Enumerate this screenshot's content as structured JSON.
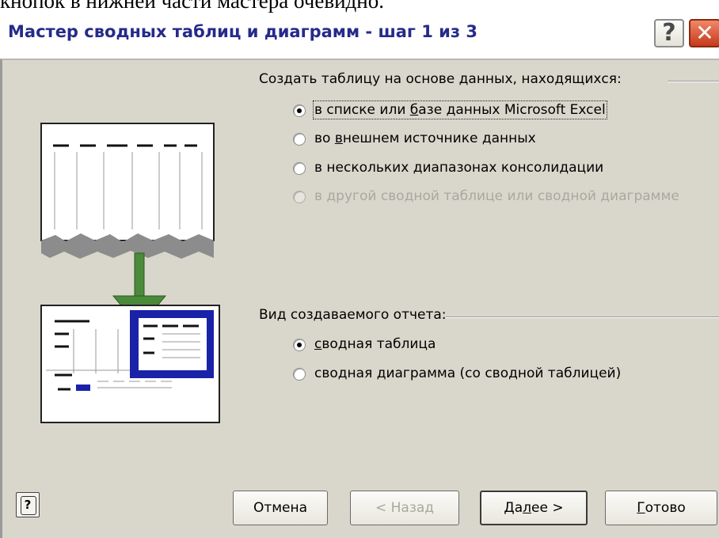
{
  "page_snippet": "кнопок в нижней части мастера очевидно.",
  "window": {
    "title": "Мастер сводных таблиц и диаграмм - шаг 1 из 3",
    "help_glyph": "?",
    "close_glyph": "✕"
  },
  "source_group": {
    "label": "Создать таблицу на основе данных, находящихся:",
    "options": [
      {
        "pre": "в списке или ",
        "hot": "б",
        "post": "азе данных Microsoft Excel",
        "selected": true,
        "enabled": true
      },
      {
        "pre": "во ",
        "hot": "в",
        "post": "нешнем источнике данных",
        "selected": false,
        "enabled": true
      },
      {
        "pre": "в нескольких ",
        "hot": "д",
        "post": "иапазонах консолидации",
        "selected": false,
        "enabled": true
      },
      {
        "pre": "в другой сводной таблице или сводной диаграмме",
        "hot": "",
        "post": "",
        "selected": false,
        "enabled": false
      }
    ]
  },
  "report_group": {
    "label": "Вид создаваемого отчета:",
    "options": [
      {
        "pre": "",
        "hot": "с",
        "post": "водная таблица",
        "selected": true,
        "enabled": true
      },
      {
        "pre": "сво",
        "hot": "д",
        "post": "ная диаграмма (со сводной таблицей)",
        "selected": false,
        "enabled": true
      }
    ]
  },
  "buttons": {
    "help_glyph": "?",
    "cancel": "Отмена",
    "back": "< Назад",
    "next": {
      "pre": "Да",
      "hot": "л",
      "post": "ее >"
    },
    "finish": {
      "pre": "",
      "hot": "Г",
      "post": "отово"
    }
  },
  "colors": {
    "title_text": "#252b8a",
    "dialog_bg": "#d9d7cc",
    "arrow_green": "#4a8a3a",
    "pivot_blue": "#1a22a8",
    "disabled_text": "#a8a8a0"
  }
}
